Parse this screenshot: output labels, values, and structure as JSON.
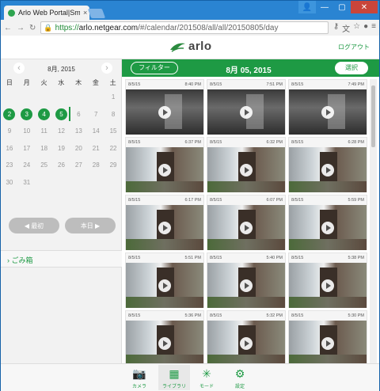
{
  "browser": {
    "tab_title": "Arlo Web Portal|Smart",
    "tab_close": "×",
    "url_https": "https://",
    "url_host": "arlo.netgear.com",
    "url_path": "/#/calendar/201508/all/all/20150805/day",
    "window_buttons": {
      "minimize": "—",
      "maximize": "▢",
      "close": "✕"
    }
  },
  "header": {
    "logo_text": "arlo",
    "logout_label": "ログアウト"
  },
  "calendar": {
    "month_label": "8月, 2015",
    "prev_label": "‹",
    "next_label": "›",
    "weekdays": [
      "日",
      "月",
      "火",
      "水",
      "木",
      "金",
      "土"
    ],
    "first_weekday_index": 6,
    "days_in_month": 31,
    "days_with_recordings": [
      2,
      3,
      4,
      5
    ],
    "selected_day": 5,
    "first_button_label": "◀ 最初",
    "today_button_label": "本日 ▶"
  },
  "sidebar": {
    "trash_label": "ごみ箱"
  },
  "library": {
    "filter_label": "フィルター",
    "date_title": "8月 05, 2015",
    "select_label": "選択",
    "clips": [
      {
        "date": "8/5/15",
        "time": "8:40 PM",
        "scene": "night"
      },
      {
        "date": "8/5/15",
        "time": "7:51 PM",
        "scene": "night"
      },
      {
        "date": "8/5/15",
        "time": "7:49 PM",
        "scene": "night"
      },
      {
        "date": "8/5/15",
        "time": "6:37 PM",
        "scene": "day"
      },
      {
        "date": "8/5/15",
        "time": "6:32 PM",
        "scene": "day"
      },
      {
        "date": "8/5/15",
        "time": "6:28 PM",
        "scene": "day"
      },
      {
        "date": "8/5/15",
        "time": "6:17 PM",
        "scene": "day"
      },
      {
        "date": "8/5/15",
        "time": "6:07 PM",
        "scene": "day"
      },
      {
        "date": "8/5/15",
        "time": "5:59 PM",
        "scene": "day"
      },
      {
        "date": "8/5/15",
        "time": "5:51 PM",
        "scene": "day"
      },
      {
        "date": "8/5/15",
        "time": "5:40 PM",
        "scene": "day"
      },
      {
        "date": "8/5/15",
        "time": "5:38 PM",
        "scene": "day"
      },
      {
        "date": "8/5/15",
        "time": "5:36 PM",
        "scene": "day"
      },
      {
        "date": "8/5/15",
        "time": "5:32 PM",
        "scene": "day"
      },
      {
        "date": "8/5/15",
        "time": "5:30 PM",
        "scene": "day"
      }
    ]
  },
  "footer": {
    "items": [
      {
        "label": "カメラ",
        "icon": "camera-icon"
      },
      {
        "label": "ライブラリ",
        "icon": "library-icon"
      },
      {
        "label": "モード",
        "icon": "mode-icon"
      },
      {
        "label": "設定",
        "icon": "settings-icon"
      }
    ]
  },
  "colors": {
    "accent": "#1e9a44",
    "chrome": "#2a84d2"
  }
}
